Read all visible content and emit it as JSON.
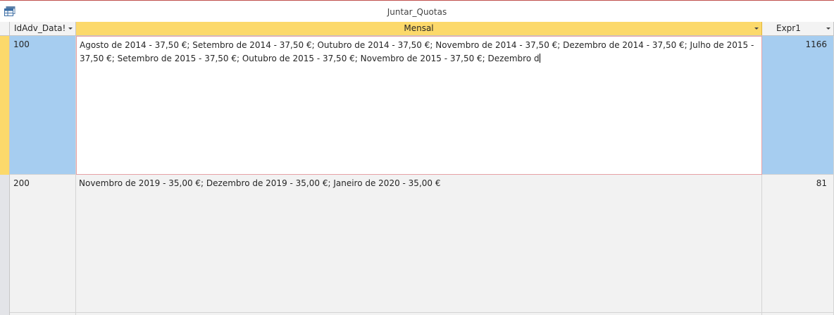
{
  "window": {
    "title": "Juntar_Quotas",
    "icon": "datasheet-icon"
  },
  "columns": [
    {
      "label": "IdAdv_Data!"
    },
    {
      "label": "Mensal"
    },
    {
      "label": "Expr1"
    }
  ],
  "rows": [
    {
      "id": "100",
      "mensal": "Agosto de 2014 - 37,50 €; Setembro de 2014 - 37,50 €; Outubro de 2014 - 37,50 €; Novembro de 2014 - 37,50 €; Dezembro de 2014 - 37,50 €; Julho de 2015 - 37,50 €; Setembro de 2015 - 37,50 €; Outubro de 2015 - 37,50 €; Novembro de 2015 - 37,50 €; Dezembro d",
      "expr1": "1166"
    },
    {
      "id": "200",
      "mensal": "Novembro de 2019 - 35,00 €; Dezembro de 2019 - 35,00 €; Janeiro de 2020 - 35,00 €",
      "expr1": "81"
    }
  ],
  "colors": {
    "selected_header": "#fcd96b",
    "selected_cell": "#a6cdf0",
    "active_cell_border": "#e7a1a5"
  }
}
